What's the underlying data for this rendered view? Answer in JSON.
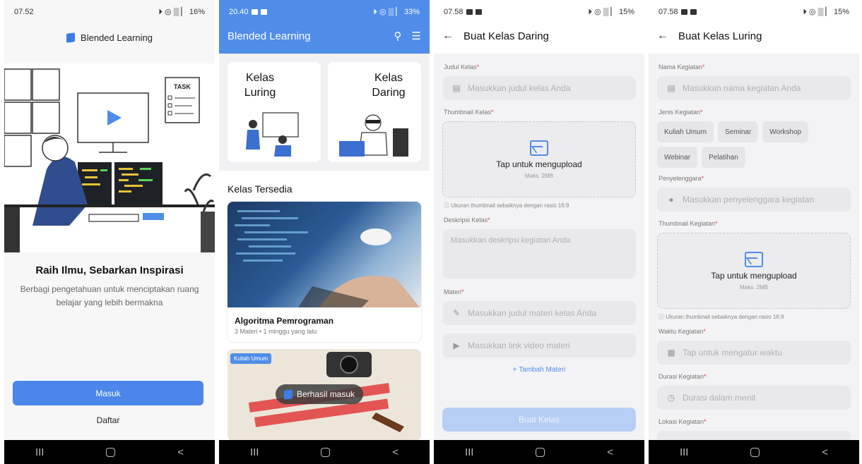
{
  "screen1": {
    "status": {
      "time": "07.52",
      "right": "⏵ ◎ ▒ ▏ 16%"
    },
    "brand": "Blended Learning",
    "task_sign": "TASK",
    "hero_title": "Raih Ilmu, Sebarkan Inspirasi",
    "hero_subtitle": "Berbagi pengetahuan untuk menciptakan ruang belajar yang lebih bermakna",
    "login_label": "Masuk",
    "register_label": "Daftar"
  },
  "screen2": {
    "status": {
      "time": "20.40",
      "right": "⏵ ◎ ▒ ▏ 33%"
    },
    "app_title": "Blended Learning",
    "card_luring": "Kelas Luring",
    "card_daring": "Kelas Daring",
    "section_title": "Kelas Tersedia",
    "course1": {
      "name": "Algoritma Pemrograman",
      "meta": "3 Materi • 1 minggu yang lalu"
    },
    "course2": {
      "badge": "Kuliah Umum"
    },
    "toast": "Berhasil masuk"
  },
  "screen3": {
    "status": {
      "time": "07.58",
      "right": "⏵ ◎ ▒ ▏ 15%"
    },
    "title": "Buat Kelas Daring",
    "judul_label": "Judul Kelas",
    "judul_placeholder": "Masukkan judul kelas Anda",
    "thumb_label": "Thumbnail Kelas",
    "upload_text": "Tap untuk mengupload",
    "upload_max": "Maks. 2MB",
    "thumb_hint": "ⓘ Ukuran thumbnail sebaiknya dengan rasio 16:9",
    "desc_label": "Deskripsi Kelas",
    "desc_placeholder": "Masukkan deskripsi kegiatan Anda",
    "materi_label": "Materi",
    "materi_title_placeholder": "Masukkan judul materi kelas Anda",
    "materi_link_placeholder": "Masukkan link video materi",
    "add_materi": "+ Tambah Materi",
    "submit": "Buat Kelas"
  },
  "screen4": {
    "status": {
      "time": "07.58",
      "right": "⏵ ◎ ▒ ▏ 15%"
    },
    "title": "Buat Kelas Luring",
    "nama_label": "Nama Kegiatan",
    "nama_placeholder": "Masukkan nama kegiatan Anda",
    "jenis_label": "Jenis Kegiatan",
    "jenis_options": [
      "Kuliah Umum",
      "Seminar",
      "Workshop",
      "Webinar",
      "Pelatihan"
    ],
    "penyelenggara_label": "Penyelenggara",
    "penyelenggara_placeholder": "Masukkan penyelenggara kegiatan",
    "thumb_label": "Thumbnail Kegiatan",
    "upload_text": "Tap untuk mengupload",
    "upload_max": "Maks. 2MB",
    "thumb_hint": "ⓘ Ukuran thumbnail sebaiknya dengan rasio 16:9",
    "waktu_label": "Waktu Kegiatan",
    "waktu_placeholder": "Tap untuk mengatur waktu",
    "durasi_label": "Durasi Kegiatan",
    "durasi_placeholder": "Durasi dalam menit",
    "lokasi_label": "Lokasi Kegiatan"
  },
  "navbar": {
    "recent": "III",
    "back": "<"
  },
  "colors": {
    "primary": "#4f8de8",
    "required": "#e5484d"
  }
}
